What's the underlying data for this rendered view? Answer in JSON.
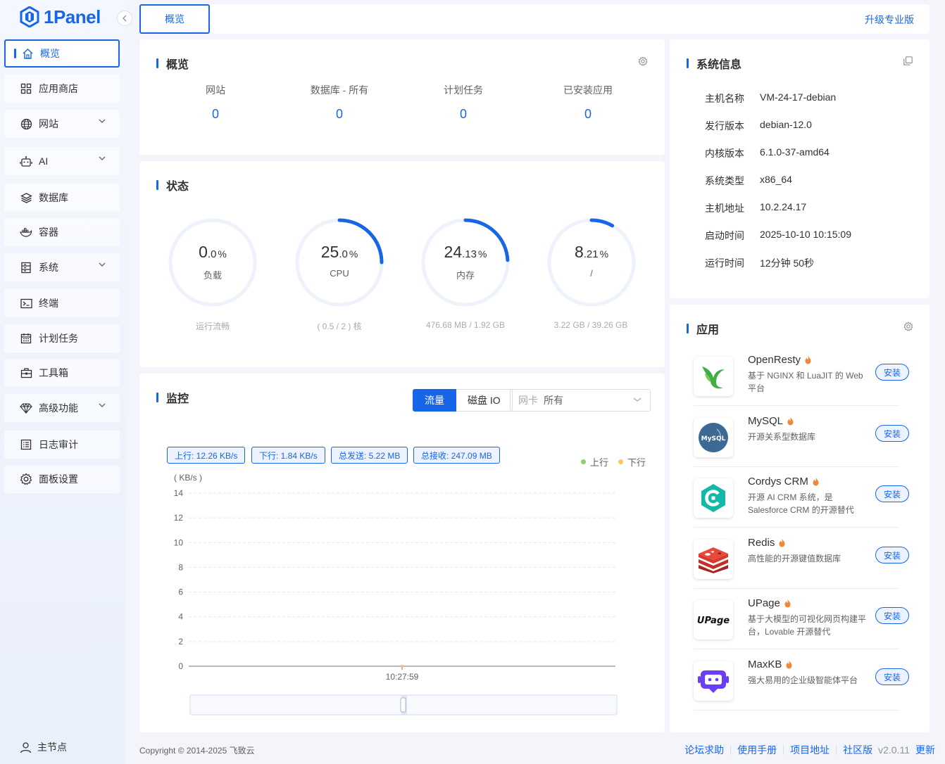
{
  "brand": {
    "name": "1Panel",
    "accent": "#1766e8"
  },
  "sidebar": {
    "items": [
      {
        "label": "概览",
        "icon": "home-icon",
        "active": true
      },
      {
        "label": "应用商店",
        "icon": "grid-icon"
      },
      {
        "label": "网站",
        "icon": "globe-icon",
        "expandable": true
      },
      {
        "label": "AI",
        "icon": "robot-icon",
        "expandable": true
      },
      {
        "label": "数据库",
        "icon": "layers-icon"
      },
      {
        "label": "容器",
        "icon": "docker-icon"
      },
      {
        "label": "系统",
        "icon": "server-icon",
        "expandable": true
      },
      {
        "label": "终端",
        "icon": "terminal-icon"
      },
      {
        "label": "计划任务",
        "icon": "calendar-icon"
      },
      {
        "label": "工具箱",
        "icon": "toolbox-icon"
      },
      {
        "label": "高级功能",
        "icon": "diamond-icon",
        "expandable": true
      },
      {
        "label": "日志审计",
        "icon": "log-icon"
      },
      {
        "label": "面板设置",
        "icon": "gear-icon"
      }
    ],
    "footer_label": "主节点"
  },
  "topbar": {
    "tab": "概览",
    "upgrade": "升级专业版"
  },
  "overview": {
    "title": "概览",
    "stats": [
      {
        "label": "网站",
        "value": "0"
      },
      {
        "label": "数据库 - 所有",
        "value": "0"
      },
      {
        "label": "计划任务",
        "value": "0"
      },
      {
        "label": "已安装应用",
        "value": "0"
      }
    ]
  },
  "status": {
    "title": "状态",
    "gauges": [
      {
        "int": "0",
        "dec": ".0",
        "unit": "%",
        "label": "负载",
        "sub": "运行流畅",
        "percent": 0.0
      },
      {
        "int": "25",
        "dec": ".0",
        "unit": "%",
        "label": "CPU",
        "sub": "( 0.5 / 2 ) 核",
        "percent": 25.0
      },
      {
        "int": "24",
        "dec": ".13",
        "unit": "%",
        "label": "内存",
        "sub": "476.68 MB / 1.92 GB",
        "percent": 24.13
      },
      {
        "int": "8",
        "dec": ".21",
        "unit": "%",
        "label": "/",
        "sub": "3.22 GB / 39.26 GB",
        "percent": 8.21
      }
    ]
  },
  "monitor": {
    "title": "监控",
    "tabs": [
      "流量",
      "磁盘 IO"
    ],
    "active_tab": "流量",
    "nic_label": "网卡",
    "nic_value": "所有",
    "tags": [
      "上行: 12.26 KB/s",
      "下行: 1.84 KB/s",
      "总发送: 5.22 MB",
      "总接收: 247.09 MB"
    ],
    "legend": [
      {
        "name": "上行",
        "color": "#91cc75"
      },
      {
        "name": "下行",
        "color": "#fac858"
      }
    ]
  },
  "chart_data": {
    "type": "line",
    "ylabel": "( KB/s )",
    "ylim": [
      0,
      14
    ],
    "yticks": [
      "14",
      "12",
      "10",
      "8",
      "6",
      "4",
      "2",
      "0"
    ],
    "x": [
      "10:27:59"
    ],
    "series": [
      {
        "name": "上行",
        "values": [
          0
        ]
      },
      {
        "name": "下行",
        "values": [
          0
        ]
      }
    ],
    "grid": true,
    "legend_position": "top-right"
  },
  "sysinfo": {
    "title": "系统信息",
    "rows": [
      {
        "k": "主机名称",
        "v": "VM-24-17-debian"
      },
      {
        "k": "发行版本",
        "v": "debian-12.0"
      },
      {
        "k": "内核版本",
        "v": "6.1.0-37-amd64"
      },
      {
        "k": "系统类型",
        "v": "x86_64"
      },
      {
        "k": "主机地址",
        "v": "10.2.24.17"
      },
      {
        "k": "启动时间",
        "v": "2025-10-10 10:15:09"
      },
      {
        "k": "运行时间",
        "v": "12分钟 50秒"
      }
    ]
  },
  "apps": {
    "title": "应用",
    "install_label": "安装",
    "items": [
      {
        "name": "OpenResty",
        "desc": "基于 NGINX 和 LuaJIT 的 Web 平台",
        "icon": "openresty-icon"
      },
      {
        "name": "MySQL",
        "desc": "开源关系型数据库",
        "icon": "mysql-icon",
        "logo_text": "MySQL"
      },
      {
        "name": "Cordys CRM",
        "desc": "开源 AI CRM 系统，是 Salesforce CRM 的开源替代",
        "icon": "cordys-icon"
      },
      {
        "name": "Redis",
        "desc": "高性能的开源键值数据库",
        "icon": "redis-icon"
      },
      {
        "name": "UPage",
        "desc": "基于大模型的可视化网页构建平台，Lovable 开源替代",
        "icon": "upage-icon",
        "logo_text": "UPage"
      },
      {
        "name": "MaxKB",
        "desc": "强大易用的企业级智能体平台",
        "icon": "maxkb-icon"
      }
    ]
  },
  "footer": {
    "copyright": "Copyright © 2014-2025 飞致云",
    "links": [
      "论坛求助",
      "使用手册",
      "项目地址",
      "社区版"
    ],
    "version": "v2.0.11",
    "update": "更新"
  }
}
